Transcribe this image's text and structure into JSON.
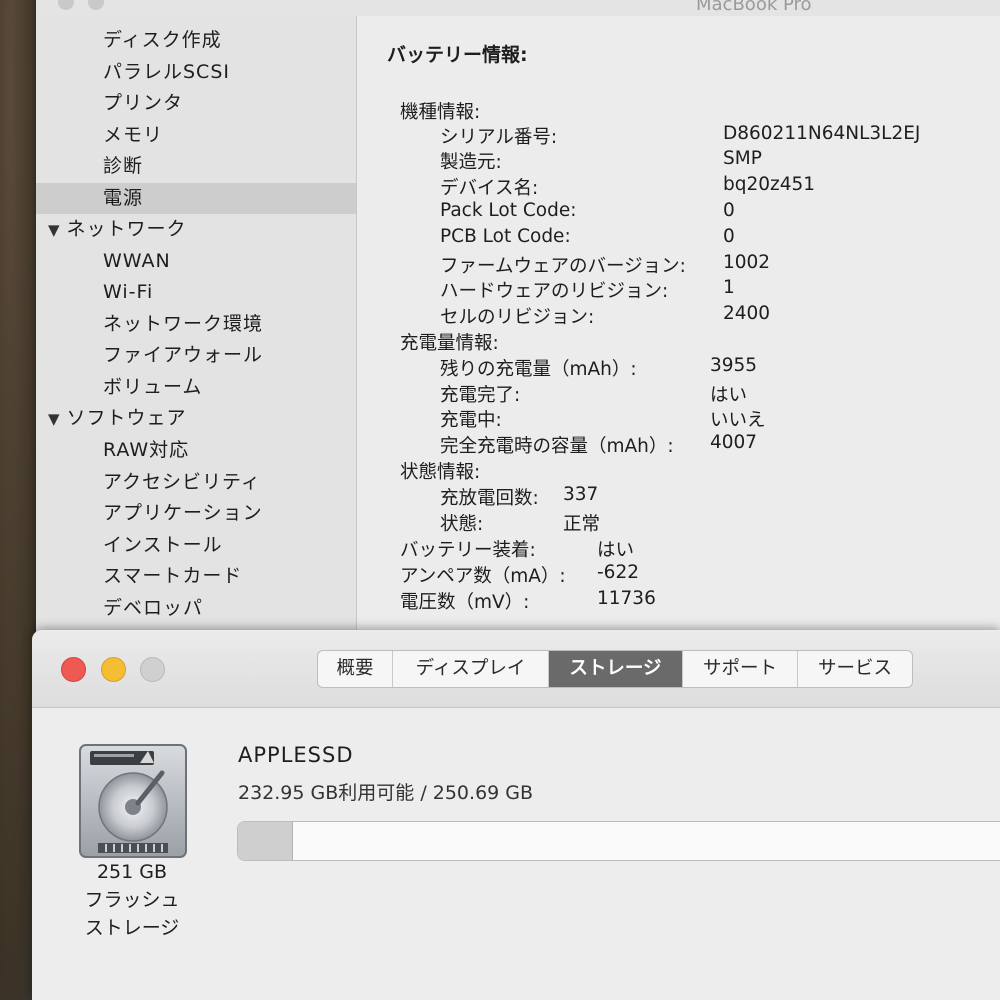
{
  "sysinfo": {
    "title": "MacBook Pro",
    "sidebar": {
      "items": [
        {
          "label": "ディスク作成",
          "kind": "child"
        },
        {
          "label": "パラレルSCSI",
          "kind": "child"
        },
        {
          "label": "プリンタ",
          "kind": "child"
        },
        {
          "label": "メモリ",
          "kind": "child"
        },
        {
          "label": "診断",
          "kind": "child"
        },
        {
          "label": "電源",
          "kind": "child",
          "selected": true
        },
        {
          "label": "ネットワーク",
          "kind": "group"
        },
        {
          "label": "WWAN",
          "kind": "child"
        },
        {
          "label": "Wi-Fi",
          "kind": "child"
        },
        {
          "label": "ネットワーク環境",
          "kind": "child"
        },
        {
          "label": "ファイアウォール",
          "kind": "child"
        },
        {
          "label": "ボリューム",
          "kind": "child"
        },
        {
          "label": "ソフトウェア",
          "kind": "group"
        },
        {
          "label": "RAW対応",
          "kind": "child"
        },
        {
          "label": "アクセシビリティ",
          "kind": "child"
        },
        {
          "label": "アプリケーション",
          "kind": "child"
        },
        {
          "label": "インストール",
          "kind": "child"
        },
        {
          "label": "スマートカード",
          "kind": "child"
        },
        {
          "label": "デベロッパ",
          "kind": "child"
        }
      ]
    },
    "detail": {
      "heading": "バッテリー情報:",
      "model_section": "機種情報:",
      "serial_label": "シリアル番号:",
      "serial_value": "D860211N64NL3L2EJ",
      "maker_label": "製造元:",
      "maker_value": "SMP",
      "device_label": "デバイス名:",
      "device_value": "bq20z451",
      "packlot_label": "Pack Lot Code:",
      "packlot_value": "0",
      "pcblot_label": "PCB Lot Code:",
      "pcblot_value": "0",
      "firmware_label": "ファームウェアのバージョン:",
      "firmware_value": "1002",
      "hardware_label": "ハードウェアのリビジョン:",
      "hardware_value": "1",
      "cell_label": "セルのリビジョン:",
      "cell_value": "2400",
      "charge_section": "充電量情報:",
      "remaining_label": "残りの充電量（mAh）:",
      "remaining_value": "3955",
      "charged_label": "充電完了:",
      "charged_value": "はい",
      "charging_label": "充電中:",
      "charging_value": "いいえ",
      "fullcap_label": "完全充電時の容量（mAh）:",
      "fullcap_value": "4007",
      "status_section": "状態情報:",
      "cycles_label": "充放電回数:",
      "cycles_value": "337",
      "condition_label": "状態:",
      "condition_value": "正常",
      "installed_label": "バッテリー装着:",
      "installed_value": "はい",
      "amperage_label": "アンペア数（mA）:",
      "amperage_value": "-622",
      "voltage_label": "電圧数（mV）:",
      "voltage_value": "11736"
    }
  },
  "about": {
    "tabs": [
      {
        "label": "概要"
      },
      {
        "label": "ディスプレイ"
      },
      {
        "label": "ストレージ",
        "active": true
      },
      {
        "label": "サポート"
      },
      {
        "label": "サービス"
      }
    ],
    "storage": {
      "drive_icon": "hard-drive-icon",
      "size": "251 GB",
      "type_line1": "フラッシュ",
      "type_line2": "ストレージ",
      "volume_name": "APPLESSD",
      "capacity_text": "232.95 GB利用可能 / 250.69 GB",
      "used_fraction": 0.071
    }
  }
}
